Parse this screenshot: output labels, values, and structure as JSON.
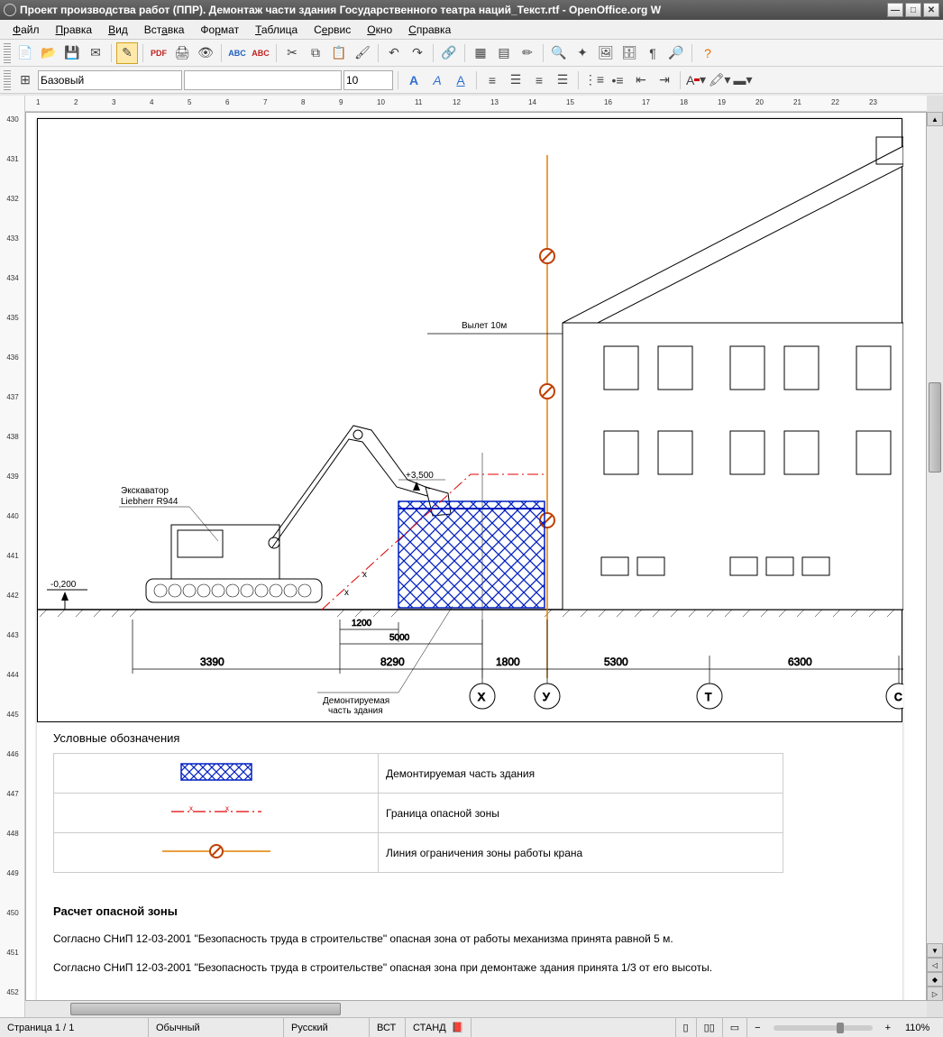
{
  "title": "Проект производства работ (ППР). Демонтаж части здания Государственного театра наций_Текст.rtf - OpenOffice.org W",
  "menu": {
    "file": "Файл",
    "edit": "Правка",
    "view": "Вид",
    "insert": "Вставка",
    "format": "Формат",
    "table": "Таблица",
    "service": "Сервис",
    "window": "Окно",
    "help": "Справка"
  },
  "format_toolbar": {
    "style": "Базовый",
    "font": "",
    "size": "10"
  },
  "hruler": [
    "1",
    "2",
    "3",
    "4",
    "5",
    "6",
    "7",
    "8",
    "9",
    "10",
    "11",
    "12",
    "13",
    "14",
    "15",
    "16",
    "17",
    "18",
    "19",
    "20",
    "21",
    "22",
    "23"
  ],
  "vruler": [
    "430",
    "431",
    "432",
    "433",
    "434",
    "435",
    "436",
    "437",
    "438",
    "439",
    "440",
    "441",
    "442",
    "443",
    "444",
    "445",
    "446",
    "447",
    "448",
    "449",
    "450",
    "451",
    "452"
  ],
  "drawing": {
    "flyout_label": "Вылет 10м",
    "elev_top": "+3,500",
    "excavator_line1": "Экскаватор",
    "excavator_line2": "Liebherr R944",
    "ground_level": "-0,200",
    "dim_1200": "1200",
    "dim_5000": "5000",
    "dim_3390": "3390",
    "dim_8290": "8290",
    "dim_1800": "1800",
    "dim_5300": "5300",
    "dim_6300": "6300",
    "demol_label1": "Демонтируемая",
    "demol_label2": "часть здания",
    "axis_x": "Х",
    "axis_y": "У",
    "axis_t": "Т",
    "axis_c": "С"
  },
  "legend_title": "Условные обозначения",
  "legend": {
    "row1": "Демонтируемая часть здания",
    "row2": "Граница опасной зоны",
    "row3": "Линия ограничения зоны работы крана"
  },
  "calc_title": "Расчет опасной зоны",
  "para1": "Согласно СНиП 12-03-2001 \"Безопасность труда в строительстве\" опасная зона от работы механизма принята равной 5 м.",
  "para2": "Согласно СНиП 12-03-2001 \"Безопасность труда в строительстве\" опасная зона при демонтаже здания принята 1/3 от его высоты.",
  "status": {
    "page": "Страница 1 / 1",
    "style": "Обычный",
    "lang": "Русский",
    "ins": "ВСТ",
    "std": "СТАНД",
    "zoom": "110%"
  }
}
